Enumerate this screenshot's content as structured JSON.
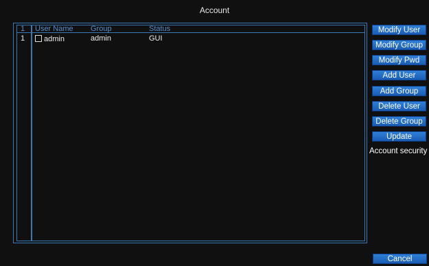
{
  "window": {
    "title": "Account"
  },
  "table": {
    "headers": {
      "index": "1",
      "user_name": "User Name",
      "group": "Group",
      "status": "Status"
    },
    "rows": [
      {
        "index": "1",
        "user_name": "admin",
        "group": "admin",
        "status": "GUI"
      }
    ]
  },
  "buttons": {
    "modify_user": "Modify User",
    "modify_group": "Modify Group",
    "modify_pwd": "Modify Pwd",
    "add_user": "Add User",
    "add_group": "Add Group",
    "delete_user": "Delete User",
    "delete_group": "Delete Group",
    "update": "Update",
    "account_security": "Account security",
    "cancel": "Cancel"
  },
  "colors": {
    "accent": "#2a72c8",
    "border": "#3a79b8",
    "header_text": "#5a8fcf",
    "background": "#101010"
  }
}
